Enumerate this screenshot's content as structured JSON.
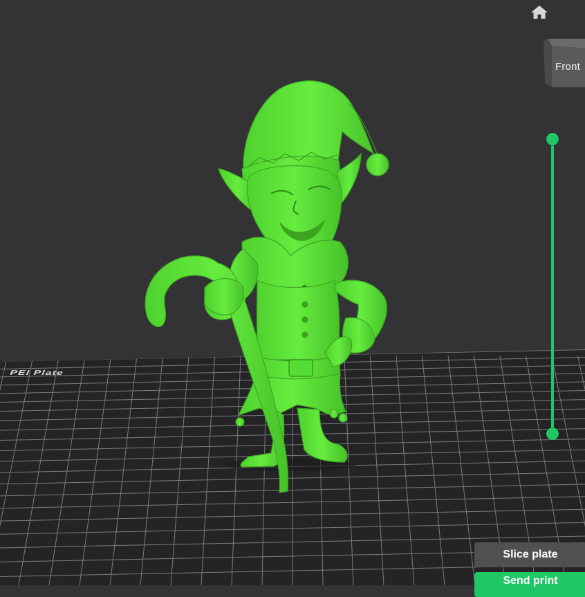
{
  "viewport": {
    "plate_label": "PEI Plate",
    "model_name": "elf",
    "model_color": "#5fe83a",
    "plate_color": "#26262a",
    "grid_color": "#7a7a7c",
    "background_color": "#333335"
  },
  "toolbar": {
    "home_icon": "home-icon"
  },
  "view_cube": {
    "face_label": "Front"
  },
  "layer_slider": {
    "color": "#1fc766"
  },
  "actions": {
    "slice_label": "Slice plate",
    "send_label": "Send print"
  }
}
